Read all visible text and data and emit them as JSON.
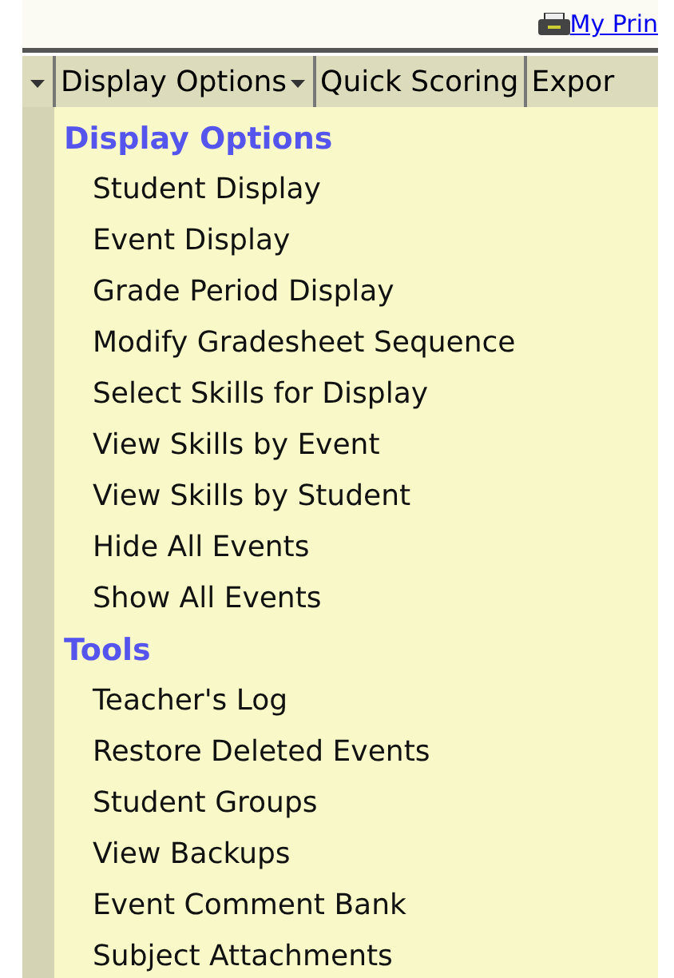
{
  "top_link": {
    "label": "My Prin"
  },
  "menu_bar": [
    {
      "dropdown": true
    },
    {
      "label": "Display Options",
      "dropdown": true
    },
    {
      "label": "Quick Scoring",
      "dropdown": false
    },
    {
      "label": "Expor",
      "dropdown": false
    }
  ],
  "menu_sections": [
    {
      "title": "Display Options",
      "items": [
        "Student Display",
        "Event Display",
        "Grade Period Display",
        "Modify Gradesheet Sequence",
        "Select Skills for Display",
        "View Skills by Event",
        "View Skills by Student",
        "Hide All Events",
        "Show All Events"
      ]
    },
    {
      "title": "Tools",
      "items": [
        "Teacher's Log",
        "Restore Deleted Events",
        "Student Groups",
        "View Backups",
        "Event Comment Bank",
        "Subject Attachments"
      ]
    }
  ]
}
